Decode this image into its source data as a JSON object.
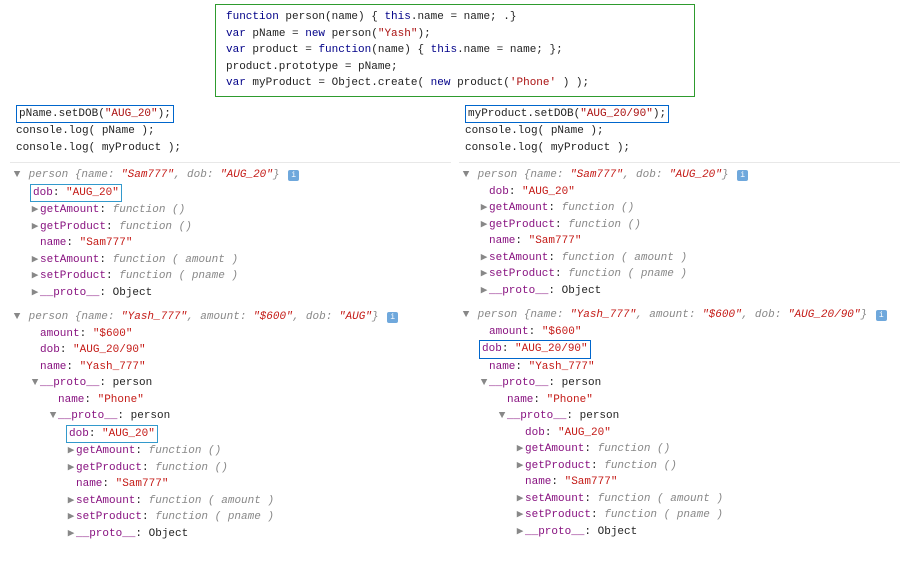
{
  "top_code": {
    "l1": {
      "a": "function",
      "b": " person(name) {  ",
      "c": "this",
      "d": ".name = name; .}"
    },
    "l2": {
      "a": "var",
      "b": " pName = ",
      "c": "new",
      "d": " person(",
      "e": "\"Yash\"",
      "f": ");"
    },
    "l3": {
      "a": "var",
      "b": " product = ",
      "c": "function",
      "d": "(name) {   ",
      "e": "this",
      "f": ".name = name;  };"
    },
    "l4": "product.prototype = pName;",
    "l5": {
      "a": "var",
      "b": " myProduct = Object.create( ",
      "c": "new",
      "d": " product(",
      "e": "'Phone'",
      "f": " ) );"
    }
  },
  "left": {
    "call": {
      "pre": "pName.setDOB(",
      "arg": "\"AUG_20\"",
      "post": ");"
    },
    "log1": "console.log( pName );",
    "log2": "console.log( myProduct  );"
  },
  "right": {
    "call": {
      "pre": "myProduct.setDOB(",
      "arg": "\"AUG_20/90\"",
      "post": ");"
    },
    "log1": "console.log( pName );",
    "log2": "console.log( myProduct  );"
  },
  "obj1": {
    "header": {
      "type": "person",
      "name": "\"Sam777\"",
      "dob": "\"AUG_20\""
    },
    "dob": "\"AUG_20\"",
    "getAmount": "function ()",
    "getProduct": "function ()",
    "name": "\"Sam777\"",
    "setAmount": "function ( amount )",
    "setProduct": "function ( pname )",
    "proto": "Object"
  },
  "obj2": {
    "header": {
      "type": "person",
      "name": "\"Yash_777\"",
      "amount": "\"$600\"",
      "dob_l": "\"AUG\"",
      "dob_r": "\"AUG_20/90\""
    },
    "amount": "\"$600\"",
    "dob": "\"AUG_20/90\"",
    "name": "\"Yash_777\"",
    "proto1_type": "person",
    "proto1_name": "\"Phone\"",
    "proto2_type": "person",
    "proto2_dob": "\"AUG_20\"",
    "getAmount": "function ()",
    "getProduct": "function ()",
    "proto2_name": "\"Sam777\"",
    "setAmount": "function ( amount )",
    "setProduct": "function ( pname )",
    "proto3": "Object"
  },
  "labels": {
    "name_k": "name",
    "dob_k": "dob",
    "amount_k": "amount",
    "getAmount_k": "getAmount",
    "getProduct_k": "getProduct",
    "setAmount_k": "setAmount",
    "setProduct_k": "setProduct",
    "proto_k": "__proto__"
  },
  "arrows": {
    "open": "▼",
    "closed": "▶"
  },
  "info": "i"
}
